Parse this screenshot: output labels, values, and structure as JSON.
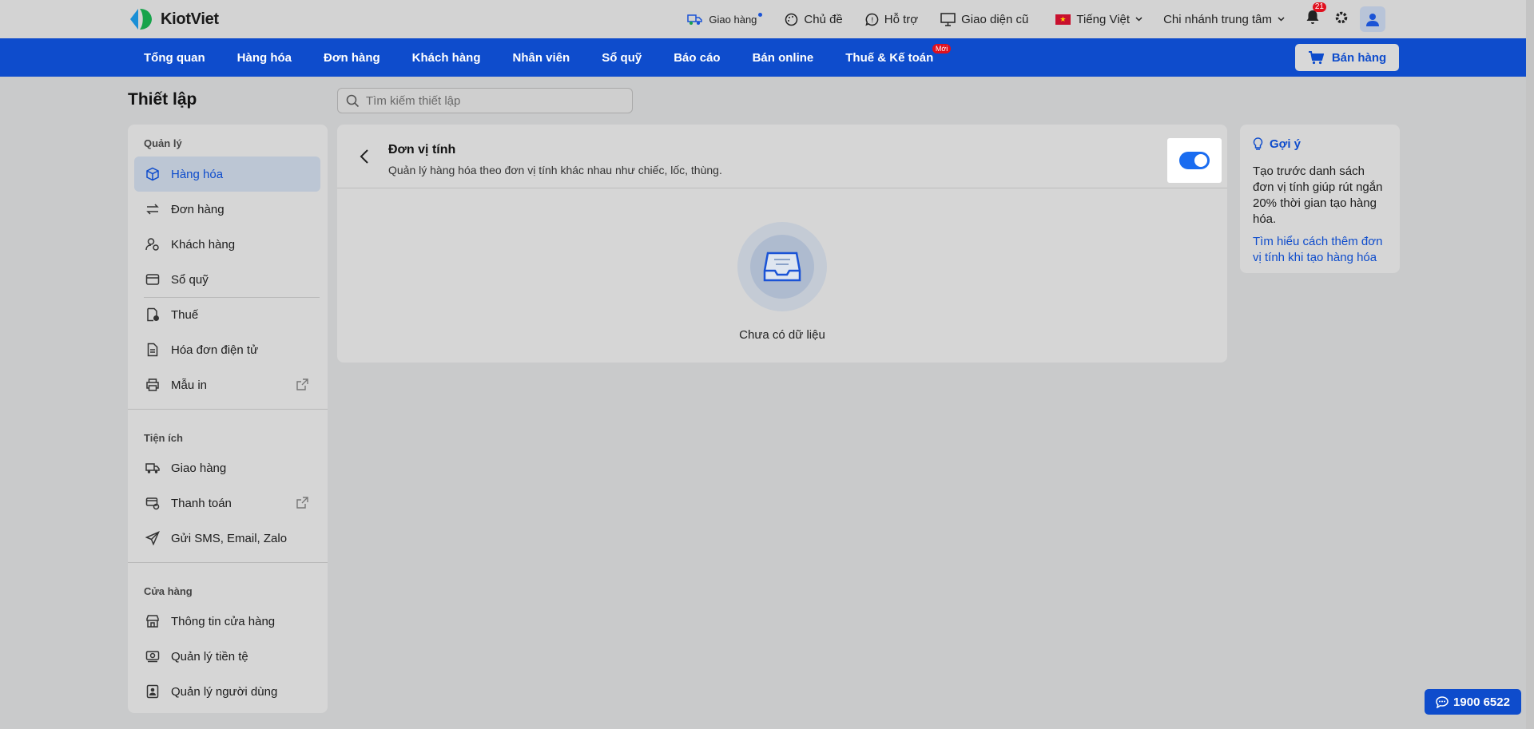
{
  "topbar": {
    "logo_text": "KiotViet",
    "delivery_label": "Giao hàng",
    "theme_label": "Chủ đề",
    "support_label": "Hỗ trợ",
    "old_ui_label": "Giao diện cũ",
    "language_label": "Tiếng Việt",
    "branch_label": "Chi nhánh trung tâm",
    "notification_count": "21"
  },
  "nav": {
    "items": [
      {
        "label": "Tổng quan"
      },
      {
        "label": "Hàng hóa"
      },
      {
        "label": "Đơn hàng"
      },
      {
        "label": "Khách hàng"
      },
      {
        "label": "Nhân viên"
      },
      {
        "label": "Sổ quỹ"
      },
      {
        "label": "Báo cáo"
      },
      {
        "label": "Bán online"
      },
      {
        "label": "Thuế & Kế toán"
      }
    ],
    "new_badge": "Mới",
    "sell_button": "Bán hàng"
  },
  "page": {
    "title": "Thiết lập",
    "search_placeholder": "Tìm kiếm thiết lập"
  },
  "sidebar": {
    "sections": [
      {
        "title": "Quản lý"
      },
      {
        "title": "Tiện ích"
      },
      {
        "title": "Cửa hàng"
      }
    ],
    "items": [
      {
        "label": "Hàng hóa"
      },
      {
        "label": "Đơn hàng"
      },
      {
        "label": "Khách hàng"
      },
      {
        "label": "Sổ quỹ"
      },
      {
        "label": "Thuế"
      },
      {
        "label": "Hóa đơn điện tử"
      },
      {
        "label": "Mẫu in"
      },
      {
        "label": "Giao hàng"
      },
      {
        "label": "Thanh toán"
      },
      {
        "label": "Gửi SMS, Email, Zalo"
      },
      {
        "label": "Thông tin cửa hàng"
      },
      {
        "label": "Quản lý tiền tệ"
      },
      {
        "label": "Quản lý người dùng"
      }
    ]
  },
  "main": {
    "title": "Đơn vị tính",
    "description": "Quản lý hàng hóa theo đơn vị tính khác nhau như chiếc, lốc, thùng.",
    "toggle_on": true,
    "empty_text": "Chưa có dữ liệu"
  },
  "hint": {
    "title": "Gợi ý",
    "body": "Tạo trước danh sách đơn vị tính giúp rút ngắn 20% thời gian tạo hàng hóa.",
    "link": "Tìm hiểu cách thêm đơn vị tính khi tạo hàng hóa"
  },
  "hotline": {
    "number": "1900 6522"
  },
  "colors": {
    "brand_blue": "#0e4ccc",
    "toggle_blue": "#1a6cf0",
    "badge_red": "#e0101e"
  }
}
